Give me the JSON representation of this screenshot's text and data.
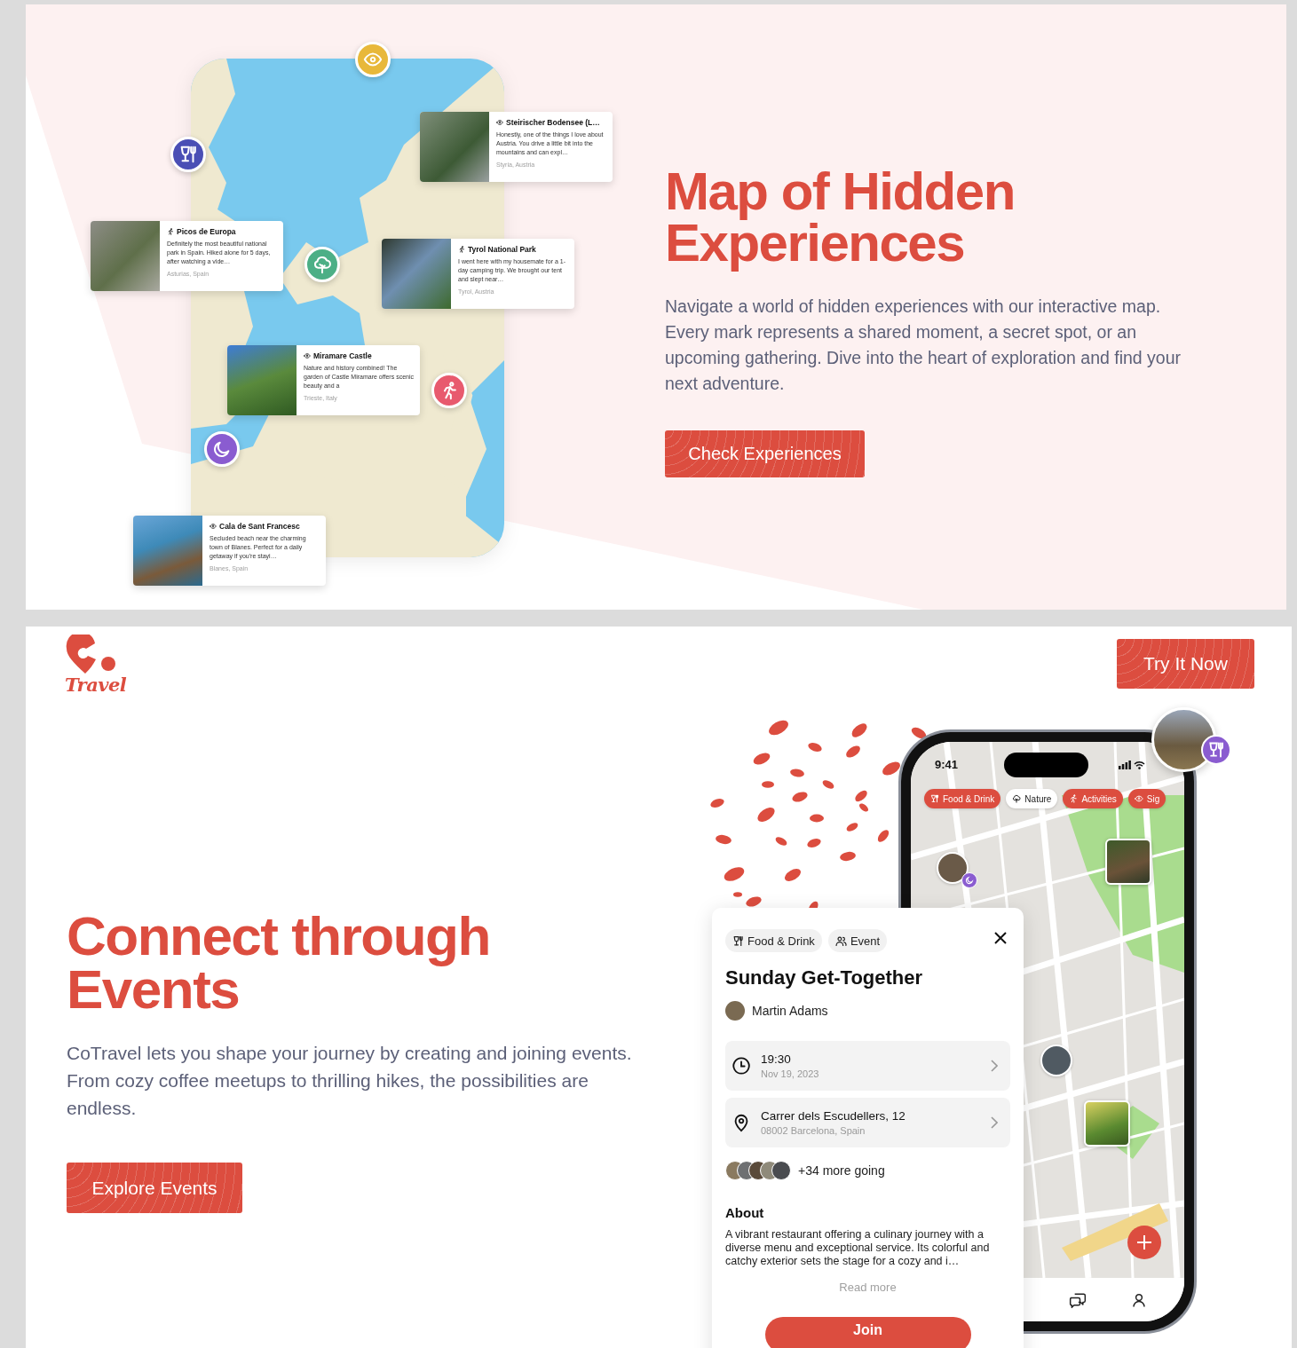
{
  "hero": {
    "map_pins": [
      {
        "kind": "sights",
        "color": "#e8b83a"
      },
      {
        "kind": "food",
        "color": "#4a4fb5"
      },
      {
        "kind": "nature",
        "color": "#4caf86"
      },
      {
        "kind": "activities",
        "color": "#e85a6e"
      },
      {
        "kind": "night",
        "color": "#8a5cd0"
      }
    ],
    "experience_cards": [
      {
        "kind": "sights",
        "title": "Steirischer Bodensee (L…",
        "text": "Honestly, one of the things I love about Austria. You drive a little bit into the mountains and can expl…",
        "location": "Styria, Austria"
      },
      {
        "kind": "activities",
        "title": "Picos de Europa",
        "text": "Definitely the most beautiful national park in Spain. Hiked alone for 5 days, after watching a vide…",
        "location": "Asturias, Spain"
      },
      {
        "kind": "activities",
        "title": "Tyrol National Park",
        "text": "I went here with my housemate for a 1-day camping trip. We brought our tent and slept near…",
        "location": "Tyrol, Austria"
      },
      {
        "kind": "sights",
        "title": "Miramare Castle",
        "text": "Nature and history combined! The garden of Castle Miramare offers scenic beauty and a",
        "location": "Trieste, Italy"
      },
      {
        "kind": "sights",
        "title": "Cala de Sant Francesc",
        "text": "Secluded beach near the charming town of Blanes. Perfect for a daily getaway if you're stayi…",
        "location": "Blanes, Spain"
      }
    ],
    "title": "Map of Hidden Experiences",
    "description": "Navigate a world of hidden experiences with our interactive map. Every mark represents a shared moment, a secret spot, or an upcoming gathering. Dive into the heart of exploration and find your next adventure.",
    "button": "Check Experiences"
  },
  "events": {
    "logo_text": "Travel",
    "cta_button": "Try It Now",
    "title": "Connect through Events",
    "description": "CoTravel lets you shape your journey by creating and joining events. From cozy coffee meetups to thrilling hikes, the possibilities are endless.",
    "button": "Explore Events",
    "phone": {
      "time": "9:41",
      "filter_chips": [
        {
          "kind": "food",
          "label": "Food & Drink",
          "selected": true
        },
        {
          "kind": "nature",
          "label": "Nature",
          "selected": false
        },
        {
          "kind": "activities",
          "label": "Activities",
          "selected": true
        },
        {
          "kind": "sights",
          "label": "Sig",
          "selected": true
        }
      ]
    },
    "event_card": {
      "tags": [
        {
          "kind": "food",
          "label": "Food & Drink"
        },
        {
          "kind": "event",
          "label": "Event"
        }
      ],
      "title": "Sunday Get-Together",
      "host": "Martin Adams",
      "info_rows": [
        {
          "kind": "time",
          "value": "19:30",
          "detail": "Nov 19, 2023"
        },
        {
          "kind": "place",
          "value": "Carrer dels Escudellers, 12",
          "detail": "08002 Barcelona, Spain"
        }
      ],
      "attendees": "+34 more going",
      "about_heading": "About",
      "about_text": "A vibrant restaurant offering a culinary journey with a diverse menu and exceptional service. Its colorful and catchy exterior sets the stage for a cozy and i…",
      "read_more": "Read more",
      "join_button": "Join"
    }
  }
}
